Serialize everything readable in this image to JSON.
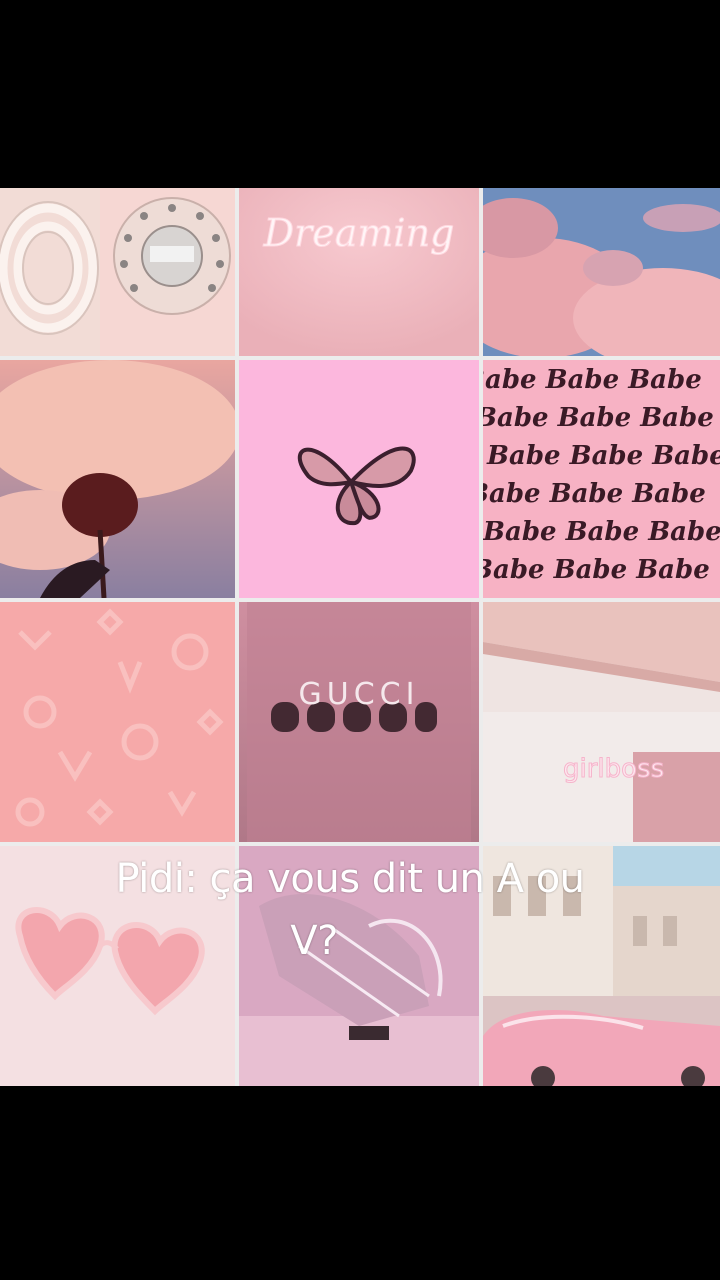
{
  "collage": {
    "tiles": [
      {
        "name": "rotary-phone-photo"
      },
      {
        "name": "neon-sign-photo",
        "text": "Dreaming"
      },
      {
        "name": "pink-clouds-sky-photo"
      },
      {
        "name": "rose-silhouette-photo"
      },
      {
        "name": "butterfly-photo"
      },
      {
        "name": "babe-pattern-photo",
        "text": "Babe"
      },
      {
        "name": "embossed-monogram-photo"
      },
      {
        "name": "gucci-sign-photo",
        "text": "GUCCI"
      },
      {
        "name": "girlboss-neon-room-photo",
        "text": "girlboss"
      },
      {
        "name": "heart-sunglasses-photo"
      },
      {
        "name": "hand-shoes-photo"
      },
      {
        "name": "pink-car-street-photo"
      }
    ]
  },
  "caption": {
    "line1": "Pidi: ça vous dit un A ou",
    "line2": "V?"
  },
  "colors": {
    "background": "#000000",
    "grid_gap": "#ececec",
    "accent_pink": "#f7a8d2"
  }
}
